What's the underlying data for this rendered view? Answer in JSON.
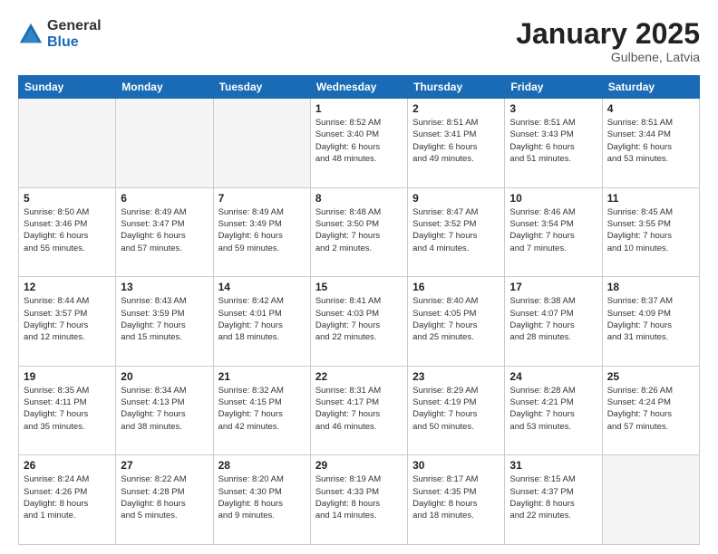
{
  "logo": {
    "general": "General",
    "blue": "Blue"
  },
  "header": {
    "month": "January 2025",
    "location": "Gulbene, Latvia"
  },
  "weekdays": [
    "Sunday",
    "Monday",
    "Tuesday",
    "Wednesday",
    "Thursday",
    "Friday",
    "Saturday"
  ],
  "weeks": [
    [
      {
        "day": "",
        "info": ""
      },
      {
        "day": "",
        "info": ""
      },
      {
        "day": "",
        "info": ""
      },
      {
        "day": "1",
        "info": "Sunrise: 8:52 AM\nSunset: 3:40 PM\nDaylight: 6 hours\nand 48 minutes."
      },
      {
        "day": "2",
        "info": "Sunrise: 8:51 AM\nSunset: 3:41 PM\nDaylight: 6 hours\nand 49 minutes."
      },
      {
        "day": "3",
        "info": "Sunrise: 8:51 AM\nSunset: 3:43 PM\nDaylight: 6 hours\nand 51 minutes."
      },
      {
        "day": "4",
        "info": "Sunrise: 8:51 AM\nSunset: 3:44 PM\nDaylight: 6 hours\nand 53 minutes."
      }
    ],
    [
      {
        "day": "5",
        "info": "Sunrise: 8:50 AM\nSunset: 3:46 PM\nDaylight: 6 hours\nand 55 minutes."
      },
      {
        "day": "6",
        "info": "Sunrise: 8:49 AM\nSunset: 3:47 PM\nDaylight: 6 hours\nand 57 minutes."
      },
      {
        "day": "7",
        "info": "Sunrise: 8:49 AM\nSunset: 3:49 PM\nDaylight: 6 hours\nand 59 minutes."
      },
      {
        "day": "8",
        "info": "Sunrise: 8:48 AM\nSunset: 3:50 PM\nDaylight: 7 hours\nand 2 minutes."
      },
      {
        "day": "9",
        "info": "Sunrise: 8:47 AM\nSunset: 3:52 PM\nDaylight: 7 hours\nand 4 minutes."
      },
      {
        "day": "10",
        "info": "Sunrise: 8:46 AM\nSunset: 3:54 PM\nDaylight: 7 hours\nand 7 minutes."
      },
      {
        "day": "11",
        "info": "Sunrise: 8:45 AM\nSunset: 3:55 PM\nDaylight: 7 hours\nand 10 minutes."
      }
    ],
    [
      {
        "day": "12",
        "info": "Sunrise: 8:44 AM\nSunset: 3:57 PM\nDaylight: 7 hours\nand 12 minutes."
      },
      {
        "day": "13",
        "info": "Sunrise: 8:43 AM\nSunset: 3:59 PM\nDaylight: 7 hours\nand 15 minutes."
      },
      {
        "day": "14",
        "info": "Sunrise: 8:42 AM\nSunset: 4:01 PM\nDaylight: 7 hours\nand 18 minutes."
      },
      {
        "day": "15",
        "info": "Sunrise: 8:41 AM\nSunset: 4:03 PM\nDaylight: 7 hours\nand 22 minutes."
      },
      {
        "day": "16",
        "info": "Sunrise: 8:40 AM\nSunset: 4:05 PM\nDaylight: 7 hours\nand 25 minutes."
      },
      {
        "day": "17",
        "info": "Sunrise: 8:38 AM\nSunset: 4:07 PM\nDaylight: 7 hours\nand 28 minutes."
      },
      {
        "day": "18",
        "info": "Sunrise: 8:37 AM\nSunset: 4:09 PM\nDaylight: 7 hours\nand 31 minutes."
      }
    ],
    [
      {
        "day": "19",
        "info": "Sunrise: 8:35 AM\nSunset: 4:11 PM\nDaylight: 7 hours\nand 35 minutes."
      },
      {
        "day": "20",
        "info": "Sunrise: 8:34 AM\nSunset: 4:13 PM\nDaylight: 7 hours\nand 38 minutes."
      },
      {
        "day": "21",
        "info": "Sunrise: 8:32 AM\nSunset: 4:15 PM\nDaylight: 7 hours\nand 42 minutes."
      },
      {
        "day": "22",
        "info": "Sunrise: 8:31 AM\nSunset: 4:17 PM\nDaylight: 7 hours\nand 46 minutes."
      },
      {
        "day": "23",
        "info": "Sunrise: 8:29 AM\nSunset: 4:19 PM\nDaylight: 7 hours\nand 50 minutes."
      },
      {
        "day": "24",
        "info": "Sunrise: 8:28 AM\nSunset: 4:21 PM\nDaylight: 7 hours\nand 53 minutes."
      },
      {
        "day": "25",
        "info": "Sunrise: 8:26 AM\nSunset: 4:24 PM\nDaylight: 7 hours\nand 57 minutes."
      }
    ],
    [
      {
        "day": "26",
        "info": "Sunrise: 8:24 AM\nSunset: 4:26 PM\nDaylight: 8 hours\nand 1 minute."
      },
      {
        "day": "27",
        "info": "Sunrise: 8:22 AM\nSunset: 4:28 PM\nDaylight: 8 hours\nand 5 minutes."
      },
      {
        "day": "28",
        "info": "Sunrise: 8:20 AM\nSunset: 4:30 PM\nDaylight: 8 hours\nand 9 minutes."
      },
      {
        "day": "29",
        "info": "Sunrise: 8:19 AM\nSunset: 4:33 PM\nDaylight: 8 hours\nand 14 minutes."
      },
      {
        "day": "30",
        "info": "Sunrise: 8:17 AM\nSunset: 4:35 PM\nDaylight: 8 hours\nand 18 minutes."
      },
      {
        "day": "31",
        "info": "Sunrise: 8:15 AM\nSunset: 4:37 PM\nDaylight: 8 hours\nand 22 minutes."
      },
      {
        "day": "",
        "info": ""
      }
    ]
  ]
}
